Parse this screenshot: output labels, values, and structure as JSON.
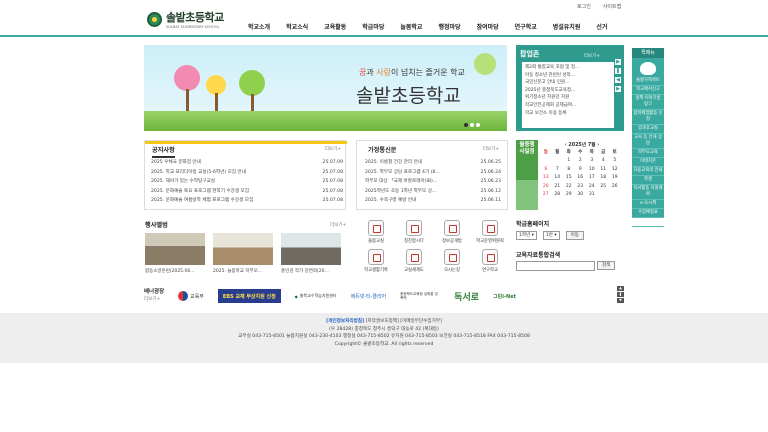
{
  "top_links": {
    "login": "로그인",
    "sitemap": "사이트맵"
  },
  "logo": {
    "name": "솔밭초등학교",
    "sub": "SOLBAT ELEMENTARY SCHOOL"
  },
  "gnb": [
    "학교소개",
    "학교소식",
    "교육활동",
    "학급마당",
    "늘봄학교",
    "행정마당",
    "참여마당",
    "연구학교",
    "병설유치원",
    "선거"
  ],
  "hero": {
    "slogan_pre": "꿈",
    "slogan_mid1": "과 ",
    "slogan_hl": "사랑",
    "slogan_post": "이 넘치는 즐거운 학교",
    "title": "솔밭초등학교"
  },
  "popup": {
    "title": "팝업존",
    "more": "더보기+",
    "items": [
      "제2회 통합교육 포럼 및 정...",
      "아동 청소년 관련된 성착...",
      "국민신문고 안내 민원...",
      "2025년 충청북도교육청...",
      "위기청소년 지원강 지원",
      "학교안전공제회 공제급여...",
      "학교 보건소 이용 등록"
    ]
  },
  "quick": {
    "title": "퀵메뉴",
    "items": [
      "솔밭가족마트",
      "학교에서신고",
      "정책·이야기방 링크",
      "참의체험활동 신청",
      "방과후교실",
      "교사 등 안내 상담",
      "학부모교육",
      "이테치온",
      "자동교육의 안내",
      "학생",
      "독서활동 지원계획",
      "e-오시책",
      "수업예정표",
      "디베이터스"
    ]
  },
  "notice": {
    "tab": "공지사항",
    "more": "더보기+",
    "rows": [
      {
        "title": "2025 우체국 문화첩 안내",
        "date": "25.07.09"
      },
      {
        "title": "2025. 학교 프리다이빙 교실(5-6학년) 모집 안내",
        "date": "25.07.08"
      },
      {
        "title": "2025. 해야가 있는 수학탐구교실",
        "date": "25.07.08"
      },
      {
        "title": "2025. 문화예술 토요 프로그램 현악기 수강생 모집",
        "date": "25.07.08"
      },
      {
        "title": "2025. 문화예술 여름방학 체험 프로그램 수강생 모집",
        "date": "25.07.08"
      }
    ]
  },
  "gate": {
    "tab": "가정통신문",
    "more": "더보기+",
    "rows": [
      {
        "title": "2025. 이름철 건강 관리 안내",
        "date": "25.06.25"
      },
      {
        "title": "2025. 학부모 상담 프로그램 4기 (8...",
        "date": "25.06.24"
      },
      {
        "title": "학부모 대상 「국제 바칼로레아(IB)...",
        "date": "25.06.23"
      },
      {
        "title": "2025학년도 초등 1학년 학부모 상...",
        "date": "25.06.12"
      },
      {
        "title": "2025. 수족구병 예방 안내",
        "date": "25.06.11"
      }
    ]
  },
  "calendar": {
    "label1": "월중행",
    "label2": "사일정",
    "month": "2025년 7월",
    "headers": [
      "일",
      "월",
      "화",
      "수",
      "목",
      "금",
      "토"
    ],
    "weeks": [
      [
        "",
        "",
        "1",
        "2",
        "3",
        "4",
        "5"
      ],
      [
        "6",
        "7",
        "8",
        "9",
        "10",
        "11",
        "12"
      ],
      [
        "13",
        "14",
        "15",
        "16",
        "17",
        "18",
        "19"
      ],
      [
        "20",
        "21",
        "22",
        "23",
        "24",
        "25",
        "26"
      ],
      [
        "27",
        "28",
        "29",
        "30",
        "31",
        "",
        ""
      ]
    ]
  },
  "gallery": {
    "title": "행사앨범",
    "more": "더보기+",
    "items": [
      "합동소방훈련(2025.06...",
      "2025. 늘봄학교 학부모...",
      "홍인검 작가 강연회(20..."
    ]
  },
  "icons": [
    {
      "label": "돌봄교실",
      "icon": "calendar-icon"
    },
    {
      "label": "칭찬합시다",
      "icon": "clipboard-icon"
    },
    {
      "label": "정보공개방",
      "icon": "lock-icon"
    },
    {
      "label": "학교운영위원회",
      "icon": "document-icon"
    },
    {
      "label": "학교생활기록",
      "icon": "book-icon"
    },
    {
      "label": "교실세계도",
      "icon": "users-icon"
    },
    {
      "label": "오시는길",
      "icon": "map-icon"
    },
    {
      "label": "연구학교",
      "icon": "search-icon"
    }
  ],
  "homepage": {
    "title": "학급홈페이지",
    "grade": "1학년",
    "cls": "1반",
    "go": "이동"
  },
  "search": {
    "title": "교육자료통합검색",
    "button": "검색"
  },
  "banner": {
    "label": "배너광장",
    "more": "더보기+",
    "items": [
      "교육부",
      "EBS 교재 무상지원 신청",
      "충북교수학습지원센터",
      "에듀넷·티-클리어",
      "충청북도교육청 성희롱 성폭력",
      "독서로",
      "그린i-Net"
    ]
  },
  "footer": {
    "privacy": "[개인정보처리방침]",
    "links": " [저작권보호정책] [이메일무단수집거부]",
    "address": "(우 28428) 충청북도 청주시 흥덕구 대농로 42 (복대동)",
    "phones": "교무실 043-715-8501 늘봄지원실 043-230-4103 행정실 043-715-8502 유치원 043-715-8503 보건실 043-715-8518 FAX 043-715-8508",
    "copyright": "Copyright© 솔밭초등학교. All rights reserved"
  },
  "colors": {
    "accent": "#3aa99f",
    "notice_bar": "#f5c518",
    "calendar": "#4c9f45"
  }
}
